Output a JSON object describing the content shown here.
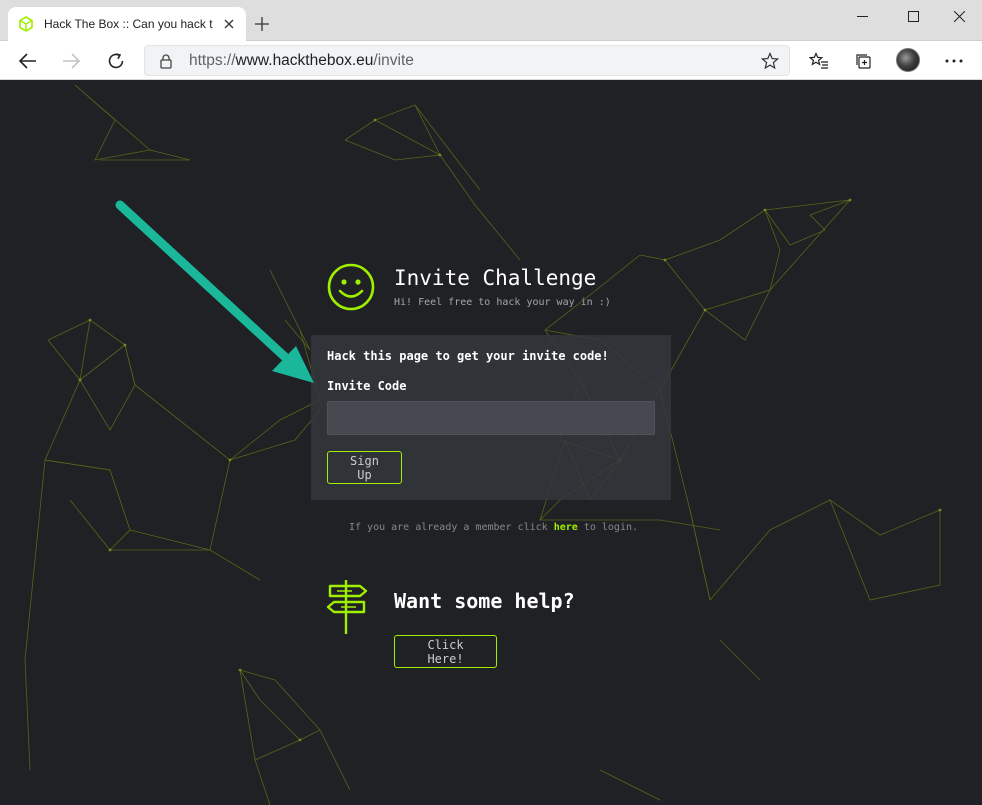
{
  "browser": {
    "tab_title": "Hack The Box :: Can you hack this",
    "url_scheme": "https://",
    "url_host": "www.hackthebox.eu",
    "url_path": "/invite"
  },
  "invite": {
    "title": "Invite Challenge",
    "subtitle": "Hi! Feel free to hack your way in :)",
    "card_heading": "Hack this page to get your invite code!",
    "field_label": "Invite Code",
    "field_value": "",
    "signup_label": "Sign Up"
  },
  "member": {
    "prefix": "If you are already a member click ",
    "link": "here",
    "suffix": " to login."
  },
  "help": {
    "title": "Want some help?",
    "button_label": "Click Here!"
  },
  "colors": {
    "accent": "#9fef00",
    "background": "#1f2125",
    "annotation_arrow": "#1ab79a"
  }
}
